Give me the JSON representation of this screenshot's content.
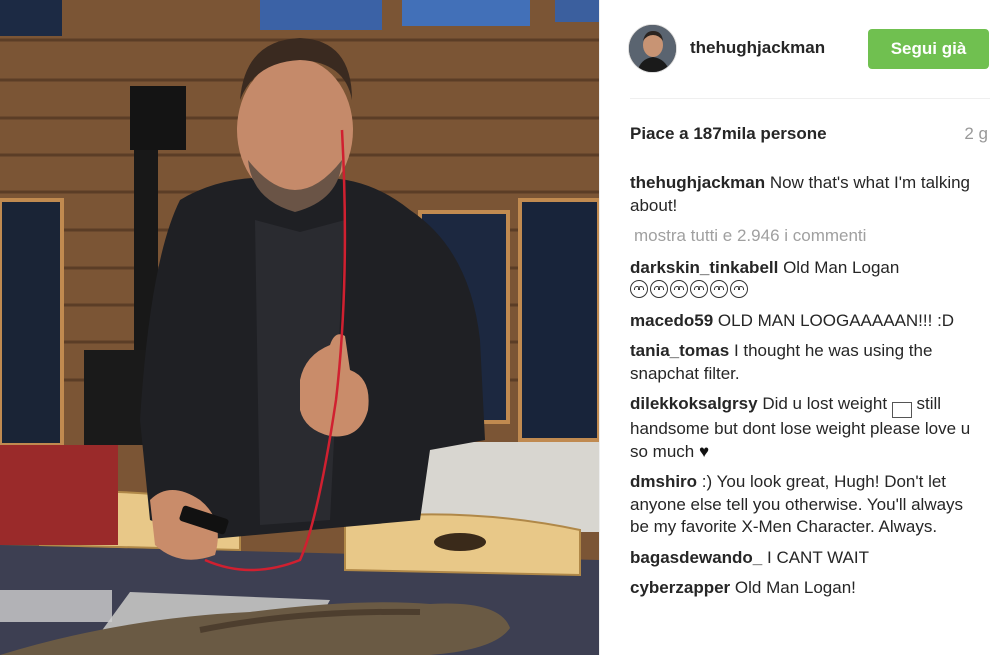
{
  "post": {
    "username": "thehughjackman",
    "follow_label": "Segui già",
    "likes": "Piace a 187mila persone",
    "time": "2 g",
    "show_all": "mostra tutti e 2.946 i commenti",
    "caption": {
      "user": "thehughjackman",
      "text": "Now that's what I'm talking about!"
    },
    "comments": [
      {
        "user": "darkskin_tinkabell",
        "text": "Old Man Logan",
        "emoji_count": 6
      },
      {
        "user": "macedo59",
        "text": "OLD MAN LOOGAAAAAN!!! :D"
      },
      {
        "user": "tania_tomas",
        "text": "I thought he was using the snapchat filter."
      },
      {
        "user": "dilekkoksalgrsy",
        "text_before": "Did u lost weight",
        "text_after": "still handsome but dont lose weight please love u so much",
        "heart": "♥"
      },
      {
        "user": "dmshiro",
        "text": ":) You look great, Hugh! Don't let anyone else tell you otherwise. You'll always be my favorite X-Men Character. Always."
      },
      {
        "user": "bagasdewando_",
        "text": "I CANT WAIT"
      },
      {
        "user": "cyberzapper",
        "text": "Old Man Logan!"
      }
    ]
  },
  "icons": {
    "emoji": "smiling-face-with-heart-eyes-icon",
    "gif": "gif-icon",
    "heart": "heart-icon"
  },
  "colors": {
    "follow_button": "#70c050",
    "muted_text": "#999999"
  }
}
